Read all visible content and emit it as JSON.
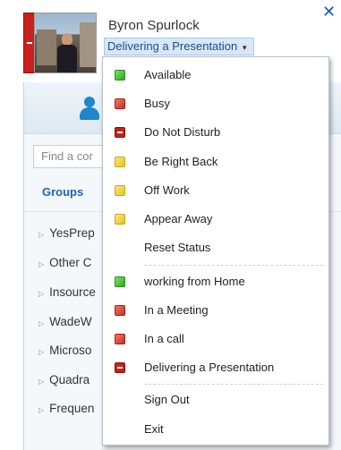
{
  "window": {
    "close_glyph": "✕"
  },
  "user": {
    "name": "Byron Spurlock",
    "status": "Delivering a Presentation",
    "presence_color": "#c8201e"
  },
  "search": {
    "placeholder": "Find a cor"
  },
  "tabs": {
    "groups": "Groups"
  },
  "groups": [
    "YesPrep",
    "Other C",
    "Insource",
    "WadeW",
    "Microso",
    "Quadra",
    "Frequen"
  ],
  "menu": {
    "status_items": [
      {
        "label": "Available",
        "icon": "presence-available-icon",
        "color": "#3bb02a"
      },
      {
        "label": "Busy",
        "icon": "presence-busy-icon",
        "color": "#d23a28"
      },
      {
        "label": "Do Not Disturb",
        "icon": "presence-dnd-icon",
        "color": "#c1221c"
      },
      {
        "label": "Be Right Back",
        "icon": "presence-brb-icon",
        "color": "#efcc32"
      },
      {
        "label": "Off Work",
        "icon": "presence-offwork-icon",
        "color": "#efcc32"
      },
      {
        "label": "Appear Away",
        "icon": "presence-away-icon",
        "color": "#efcc32"
      }
    ],
    "reset_label": "Reset Status",
    "custom_items": [
      {
        "label": "working from Home",
        "icon": "presence-available-icon",
        "color": "#3bb02a"
      },
      {
        "label": "In a Meeting",
        "icon": "presence-busy-icon",
        "color": "#d23a28"
      },
      {
        "label": "In a call",
        "icon": "presence-busy-icon",
        "color": "#d23a28"
      },
      {
        "label": "Delivering a Presentation",
        "icon": "presence-dnd-icon",
        "color": "#c1221c"
      }
    ],
    "sign_out_label": "Sign Out",
    "exit_label": "Exit"
  }
}
